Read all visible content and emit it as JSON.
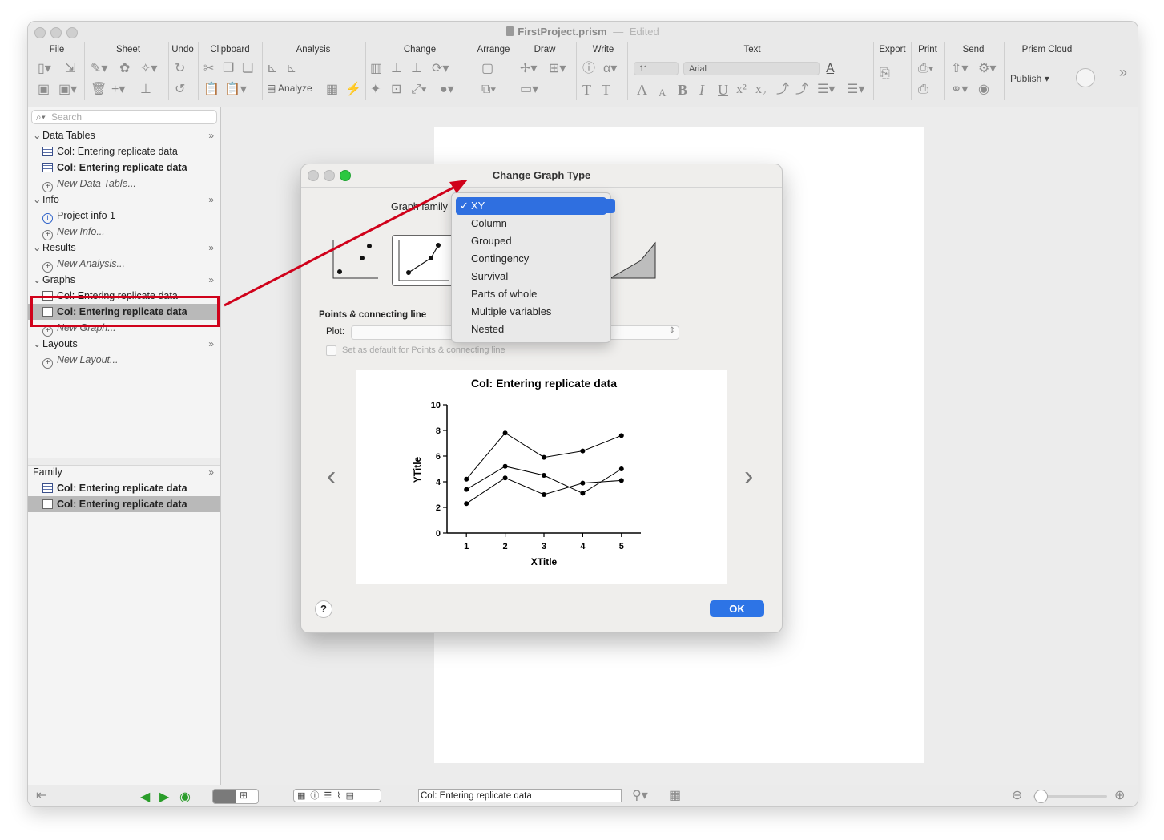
{
  "window": {
    "file_name": "FirstProject.prism",
    "separator": "—",
    "edited": "Edited"
  },
  "toolbar": {
    "groups": [
      "File",
      "Sheet",
      "Undo",
      "Clipboard",
      "Analysis",
      "Change",
      "Arrange",
      "Draw",
      "Write",
      "Text",
      "Export",
      "Print",
      "Send",
      "Prism Cloud"
    ],
    "analyze_label": "Analyze",
    "font_size": "11",
    "font_name": "Arial",
    "publish_label": "Publish"
  },
  "navigator": {
    "search_placeholder": "Search",
    "sections": {
      "data_tables": "Data Tables",
      "info": "Info",
      "results": "Results",
      "graphs": "Graphs",
      "layouts": "Layouts",
      "family": "Family"
    },
    "items": {
      "dt1": "Col: Entering replicate data",
      "dt2": "Col: Entering replicate data",
      "new_dt": "New Data Table...",
      "info1": "Project info 1",
      "new_info": "New Info...",
      "new_analysis": "New Analysis...",
      "g1": "Col: Entering replicate data",
      "g2": "Col: Entering replicate data",
      "new_graph": "New Graph...",
      "new_layout": "New Layout...",
      "fam1": "Col: Entering replicate data",
      "fam2": "Col: Entering replicate data"
    }
  },
  "dialog": {
    "title": "Change Graph Type",
    "graph_family_label": "Graph family",
    "section_label": "Points & connecting line",
    "plot_label": "Plot:",
    "default_checkbox": "Set as default for Points & connecting line",
    "ok_label": "OK",
    "help_label": "?",
    "prev_label": "‹",
    "next_label": "›"
  },
  "dropdown": {
    "check": "✓",
    "options": [
      "XY",
      "Column",
      "Grouped",
      "Contingency",
      "Survival",
      "Parts of whole",
      "Multiple variables",
      "Nested"
    ],
    "selected": "XY"
  },
  "status_bar": {
    "sheet_name": "Col: Entering replicate data"
  },
  "chart_data": {
    "type": "line",
    "title": "Col: Entering replicate data",
    "xlabel": "XTitle",
    "ylabel": "YTitle",
    "x": [
      1,
      2,
      3,
      4,
      5
    ],
    "xticks": [
      "1",
      "2",
      "3",
      "4",
      "5"
    ],
    "yticks": [
      "0",
      "2",
      "4",
      "6",
      "8",
      "10"
    ],
    "ylim": [
      0,
      10
    ],
    "series": [
      {
        "values": [
          4.2,
          7.8,
          5.9,
          6.4,
          7.6
        ]
      },
      {
        "values": [
          3.4,
          5.2,
          4.5,
          3.1,
          5.0
        ]
      },
      {
        "values": [
          2.3,
          4.3,
          3.0,
          3.9,
          4.1
        ]
      }
    ]
  },
  "colors": {
    "accent": "#2f6fe0",
    "annotation_red": "#d0021b"
  }
}
